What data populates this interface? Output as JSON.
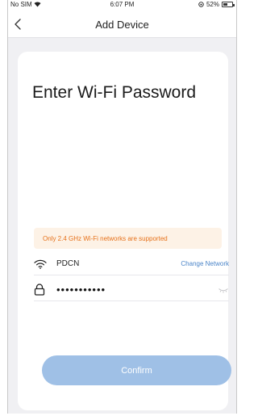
{
  "status_bar": {
    "carrier": "No SIM",
    "time": "6:07 PM",
    "battery": "52%",
    "battery_level": 0.52
  },
  "nav": {
    "title": "Add Device",
    "back_icon": "chevron-left-icon"
  },
  "main": {
    "heading": "Enter Wi-Fi Password",
    "warning": "Only 2.4 GHz Wi-Fi networks are supported",
    "network": {
      "icon": "wifi-icon",
      "ssid": "PDCN",
      "change_label": "Change Network"
    },
    "password": {
      "icon": "lock-icon",
      "value": "•••••••••••",
      "toggle_icon": "eye-closed-icon"
    },
    "confirm_label": "Confirm"
  },
  "colors": {
    "accent": "#4a84c8",
    "confirm_bg": "#9fc0e6",
    "warning_text": "#e6711a",
    "warning_bg": "#fdf2e6",
    "page_bg": "#f0f0f3"
  }
}
